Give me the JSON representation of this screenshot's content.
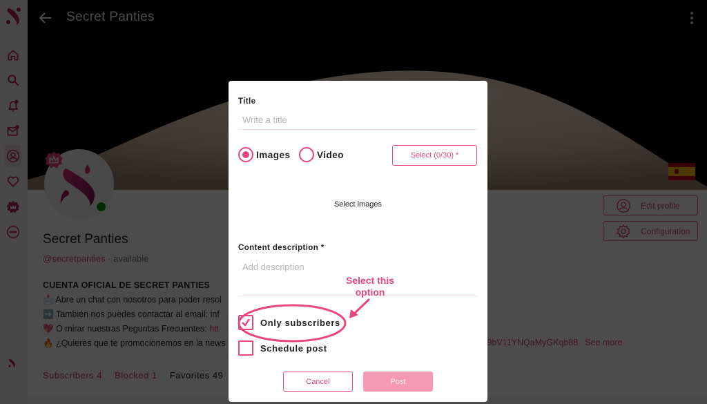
{
  "app": {
    "page_title": "Secret Panties",
    "back_icon": "arrow-left-icon",
    "more_icon": "more-vertical-icon"
  },
  "sidebar": {
    "items": [
      {
        "name": "home",
        "icon": "home-icon"
      },
      {
        "name": "search",
        "icon": "search-icon"
      },
      {
        "name": "notifications",
        "icon": "bell-icon",
        "badge": true
      },
      {
        "name": "messages",
        "icon": "mail-icon",
        "badge": true
      },
      {
        "name": "profile",
        "icon": "user-icon",
        "active": true
      },
      {
        "name": "favorites",
        "icon": "heart-icon"
      },
      {
        "name": "premium",
        "icon": "crown-icon"
      },
      {
        "name": "more",
        "icon": "more-horizontal-icon"
      }
    ]
  },
  "profile": {
    "name": "Secret Panties",
    "handle": "@secretpanties",
    "status": " · available",
    "country_flag": "Spain",
    "edit_profile_label": "Edit profile",
    "configuration_label": "Configuration",
    "bio": {
      "heading": "CUENTA OFICIAL DE SECRET PANTIES",
      "lines": [
        {
          "emoji": "📩",
          "text": "Abre un chat con nosotros para poder resol"
        },
        {
          "emoji": "➡️",
          "text": "También nos puedes contactar al email: inf"
        },
        {
          "emoji": "💖",
          "text": "O mirar nuestras Peguntas Frecuentes: ",
          "link": "htt"
        },
        {
          "emoji": "🔥",
          "text": "¿Quieres que te promocionemos en la news"
        }
      ],
      "link_tail": "/9bV11YNQaMyGKqb88",
      "see_more": "See more"
    },
    "stats": {
      "subscribers": "Subscribers 4",
      "blocked": "Blocked 1",
      "favorites": "Favorites 49"
    }
  },
  "modal": {
    "title_label": "Title",
    "title_placeholder": "Write a title",
    "title_value": "",
    "media_type": {
      "options": [
        "Images",
        "Video"
      ],
      "selected": "Images"
    },
    "select_button": "Select (0/30) *",
    "select_images_text": "Select images",
    "description_label": "Content description *",
    "description_placeholder": "Add description",
    "description_value": "",
    "only_subscribers": {
      "label": "Only subscribers",
      "checked": true
    },
    "schedule_post": {
      "label": "Schedule post",
      "checked": false
    },
    "cancel_label": "Cancel",
    "post_label": "Post"
  },
  "annotation": {
    "text_line1": "Select this",
    "text_line2": "option"
  },
  "colors": {
    "accent": "#e8467f",
    "brand_dark": "#8b1547",
    "post_disabled": "#f49ab4",
    "online": "#0a8a0a"
  }
}
